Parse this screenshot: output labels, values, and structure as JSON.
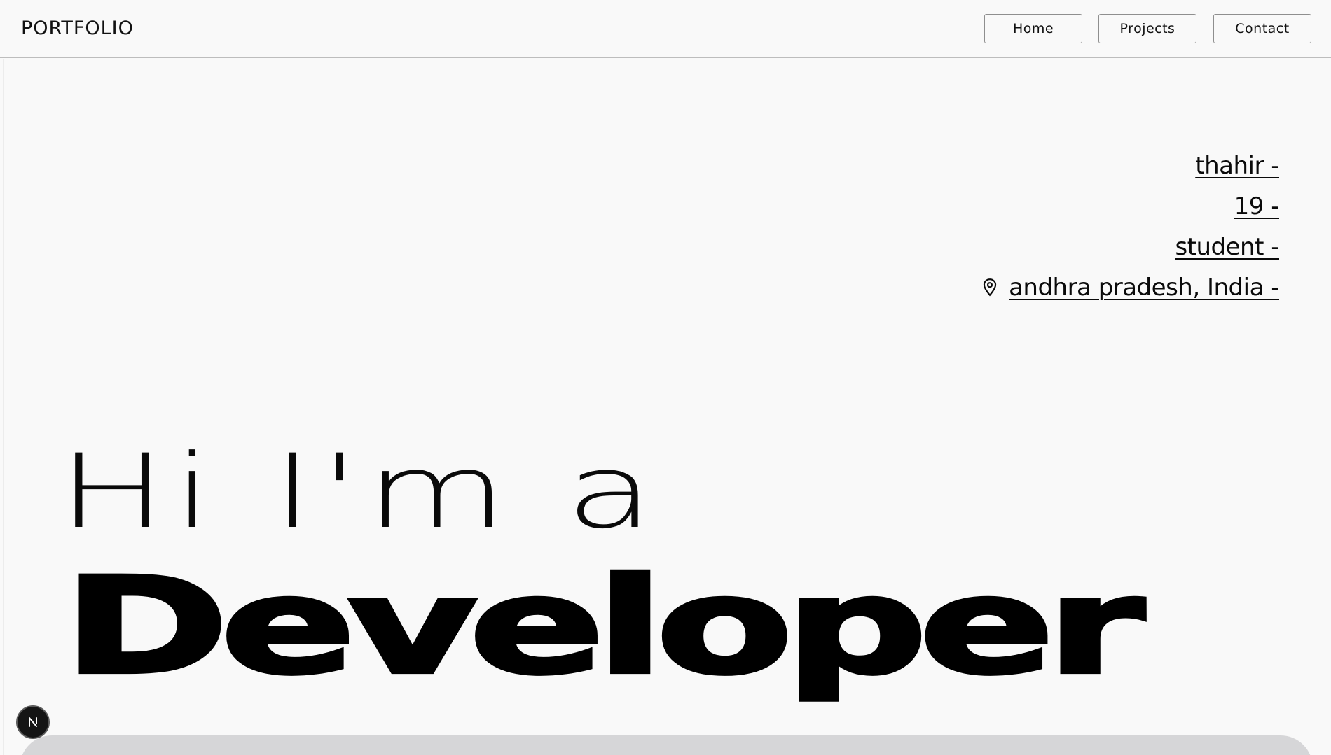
{
  "header": {
    "brand": "PORTFOLIO",
    "nav": [
      {
        "label": "Home"
      },
      {
        "label": "Projects"
      },
      {
        "label": "Contact"
      }
    ]
  },
  "info": {
    "name": "thahir -",
    "age": "19 -",
    "role": "student -",
    "location": "andhra pradesh, India -",
    "location_icon": "map-pin-icon"
  },
  "hero": {
    "greeting": "Hi I'm a",
    "title": "Developer"
  },
  "dev_badge": {
    "icon": "nextjs-logo-icon",
    "letter": "N"
  },
  "colors": {
    "background": "#f9f9f9",
    "text": "#0a0a0a",
    "bottom_panel": "#d6d6d8"
  }
}
